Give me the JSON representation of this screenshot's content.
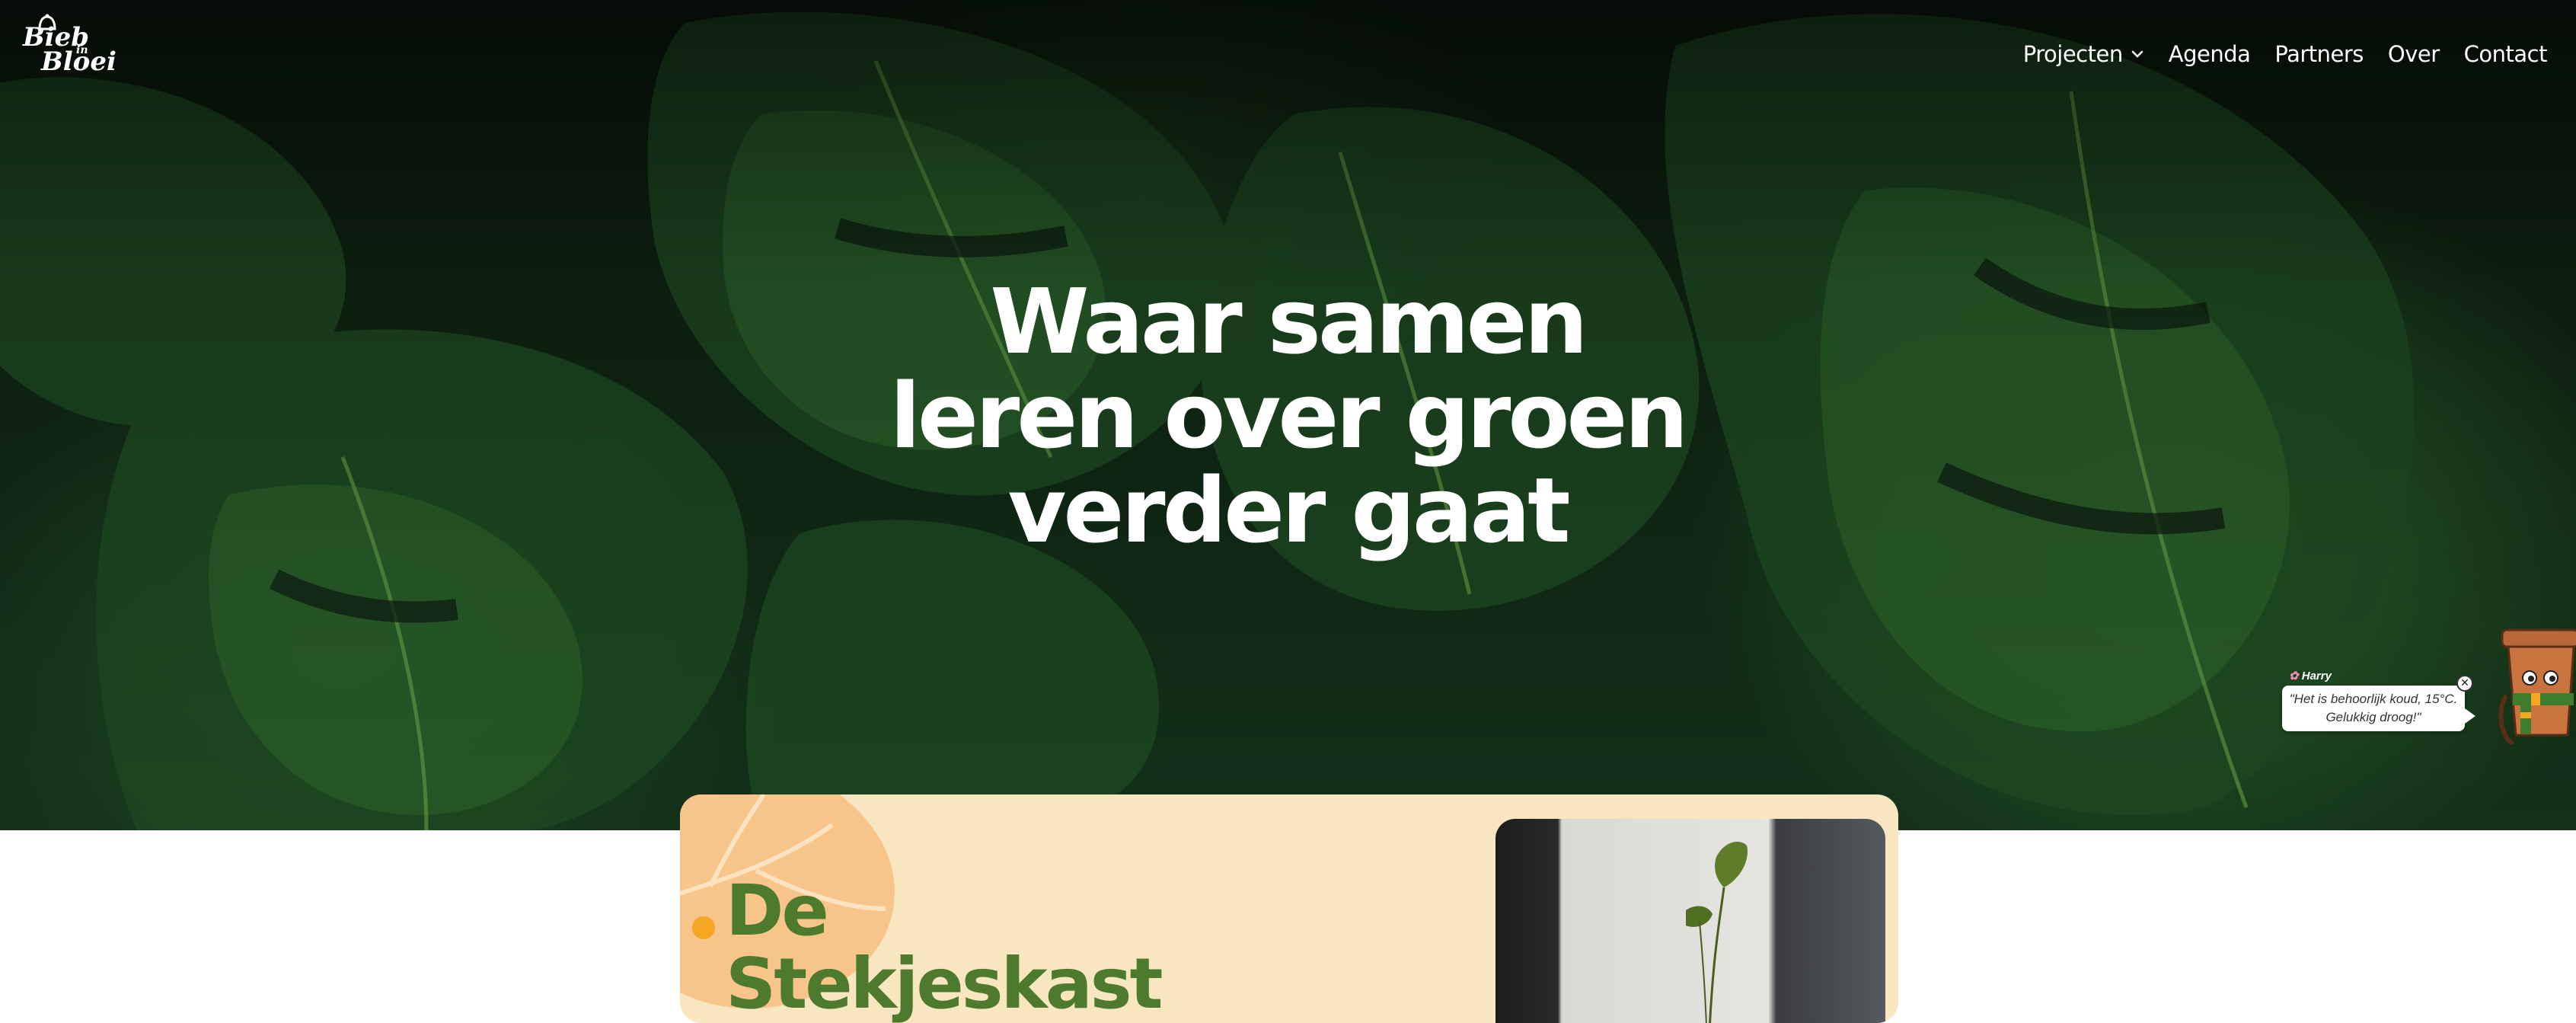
{
  "brand": {
    "logo_line1": "Bieb",
    "logo_line2": "Bloei",
    "logo_small": "in",
    "logo_icon": "bell-icon"
  },
  "nav": {
    "items": [
      {
        "label": "Projecten",
        "has_dropdown": true
      },
      {
        "label": "Agenda"
      },
      {
        "label": "Partners"
      },
      {
        "label": "Over"
      },
      {
        "label": "Contact"
      }
    ]
  },
  "hero": {
    "headline_lines": [
      "Waar samen",
      "leren over groen",
      "verder gaat"
    ]
  },
  "chat": {
    "name": "Harry",
    "message_line1": "\"Het is behoorlijk koud, 15°C.",
    "message_line2": "Gelukkig droog!\"",
    "close_icon": "close-icon",
    "mascot": "plant-pot-mascot"
  },
  "card": {
    "title_lines": [
      "De",
      "Stekjeskast"
    ]
  },
  "colors": {
    "card_background": "#f8e6c1",
    "card_title": "#4e7a2e",
    "accent_orange": "#f5a623",
    "deco_leaf": "#f7c48a"
  }
}
